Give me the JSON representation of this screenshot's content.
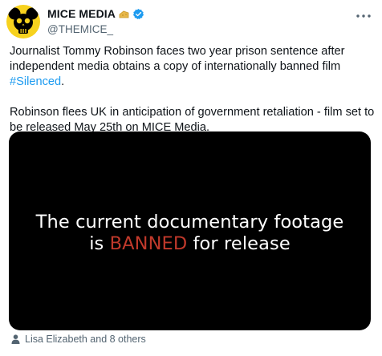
{
  "author": {
    "display_name": "MICE MEDIA",
    "handle": "@THEMICE_",
    "avatar_icon": "mouse-skull-logo",
    "verified": true,
    "colors": {
      "avatar_bg": "#f7d21e",
      "verified": "#1d9bf0",
      "badge": "#e8b84a"
    }
  },
  "post": {
    "paragraph1_text": "Journalist Tommy Robinson faces two year prison sentence after independent media obtains a copy of internationally banned film ",
    "hashtag": "#Silenced",
    "paragraph1_end": ".",
    "paragraph2_text": "Robinson flees UK in anticipation of government retaliation - film set to be released May 25th on MICE Media."
  },
  "media": {
    "caption_line1": "The current documentary footage",
    "caption_line2_pre": "is ",
    "caption_line2_highlight": "BANNED",
    "caption_line2_post": " for release",
    "colors": {
      "background": "#000000",
      "highlight": "#c0392b"
    }
  },
  "tagged": {
    "label": "Lisa Elizabeth and 8 others"
  }
}
